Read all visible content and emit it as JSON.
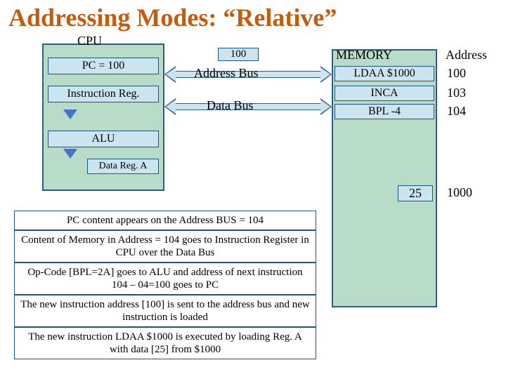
{
  "title": "Addressing Modes: “Relative”",
  "cpu": {
    "label": "CPU",
    "pc": "PC = 100",
    "ir": "Instruction Reg.",
    "alu": "ALU",
    "dra": "Data Reg. A"
  },
  "memory": {
    "head": "MEMORY",
    "addrhead": "Address",
    "rows": [
      {
        "instr": "LDAA $1000",
        "addr": "100"
      },
      {
        "instr": "INCA",
        "addr": "103"
      },
      {
        "instr": "BPL -4",
        "addr": "104"
      }
    ],
    "data_value": "25",
    "data_addr": "1000"
  },
  "buses": {
    "addr_value": "100",
    "addr_label": "Address Bus",
    "data_label": "Data Bus"
  },
  "notes": [
    "PC content appears on the Address BUS = 104",
    "Content  of Memory in Address = 104 goes to Instruction Register in CPU over the Data Bus",
    "Op-Code [BPL=2A] goes to ALU and address of next instruction 104 – 04=100 goes to PC",
    "The  new instruction address [100] is sent to the address bus and new instruction is loaded",
    "The  new instruction LDAA $1000 is executed by loading Reg. A with data [25] from $1000"
  ]
}
